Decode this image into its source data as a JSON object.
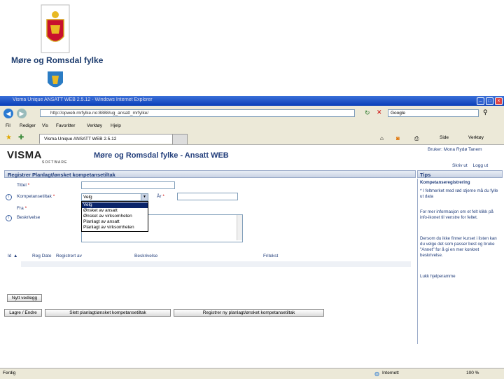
{
  "slide": {
    "county_name": "Møre og Romsdal fylke"
  },
  "browser": {
    "window_title": "Visma Unique ANSATT WEB 2.5.12 - Windows Internet Explorer",
    "url": "http://opweb.mrfylke.no:8888/ug_ansatt_mrfylke/",
    "search_placeholder": "Google",
    "menu": [
      "Fil",
      "Rediger",
      "Vis",
      "Favoritter",
      "Verktøy",
      "Hjelp"
    ],
    "tab_title": "Visma Unique ANSATT WEB 2.5.12",
    "tools": {
      "page": "Side",
      "tools": "Verktøy"
    },
    "status": {
      "left": "Ferdig",
      "zone": "Internett",
      "zoom": "100 %"
    }
  },
  "app": {
    "logo": "VISMA",
    "logo_sub": "SOFTWARE",
    "title": "Møre og Romsdal fylke - Ansatt WEB",
    "user": "Bruker: Mona Rydø Tanem",
    "link_help": "Skriv ut",
    "link_logout": "Logg ut",
    "section_title": "Registrer Planlagt/ønsket kompetansetiltak",
    "tips_title": "Tips",
    "form": {
      "label_title": "Tittel",
      "label_category": "Kompetansetiltak",
      "category_value": "Velg",
      "label_year": "År",
      "label_from": "Fra",
      "label_desc": "Beskrivelse",
      "options": [
        "Velg",
        "Ønsket av ansatt",
        "Ønsket av virksomheten",
        "Planlagt av ansatt",
        "Planlagt av virksomheten"
      ]
    },
    "grid_headers": [
      "Id",
      "Reg Date",
      "Registrert av",
      "Beskrivelse",
      "Fritekst"
    ],
    "buttons": {
      "new": "Nytt vedlegg",
      "save": "Lagre / Endre",
      "delete": "Slett planlagt/ønsket kompetansetiltak",
      "register": "Registrer ny planlagt/ønsket kompetansetiltak"
    },
    "tips": {
      "heading": "Kompetanseregistrering",
      "t1": "* I feltmerket med rød stjerne må du fylle ut data",
      "t2": "For mer informasjon om et felt klikk på info-ikonet til venstre for feltet.",
      "t3": "Dersom du ikke finner kurset i listen kan du velge det som passer best og bruke \"Annet\" for å gi en mer konkret beskrivelse.",
      "t4": "Lukk hjelperamme"
    }
  }
}
